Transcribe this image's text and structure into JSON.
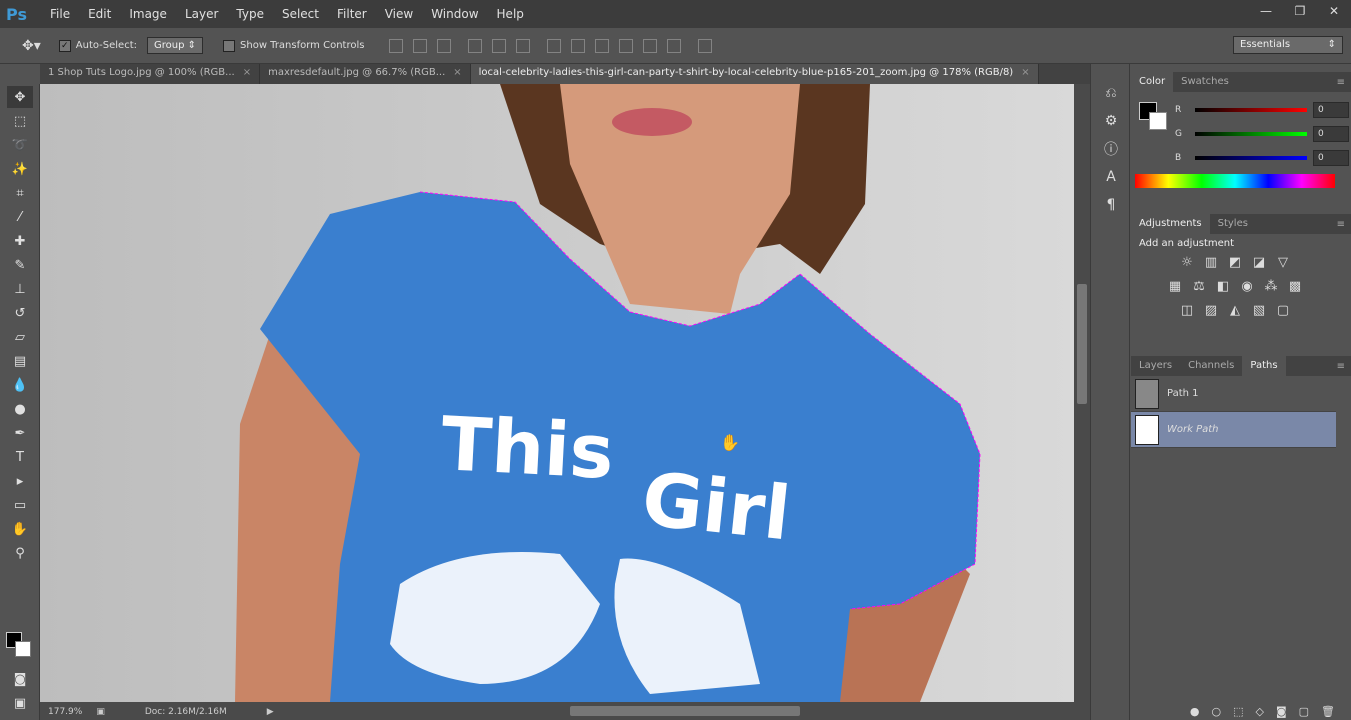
{
  "app": {
    "logo": "Ps"
  },
  "menu": [
    "File",
    "Edit",
    "Image",
    "Layer",
    "Type",
    "Select",
    "Filter",
    "View",
    "Window",
    "Help"
  ],
  "window_controls": {
    "minimize": "—",
    "restore": "❐",
    "close": "✕"
  },
  "options": {
    "autoselect_label": "Auto-Select:",
    "autoselect_value": "Group",
    "transform_label": "Show Transform Controls",
    "workspace": "Essentials"
  },
  "tabs": [
    {
      "label": "1 Shop Tuts Logo.jpg @ 100% (RGB..."
    },
    {
      "label": "maxresdefault.jpg @ 66.7% (RGB..."
    },
    {
      "label": "local-celebrity-ladies-this-girl-can-party-t-shirt-by-local-celebrity-blue-p165-201_zoom.jpg @ 178% (RGB/8)"
    }
  ],
  "tab_close": "×",
  "canvas": {
    "shirt_text_1": "This",
    "shirt_text_2": "Girl"
  },
  "status": {
    "zoom": "177.9%",
    "doc": "Doc: 2.16M/2.16M"
  },
  "color_panel": {
    "tab1": "Color",
    "tab2": "Swatches",
    "r_label": "R",
    "g_label": "G",
    "b_label": "B",
    "r": "0",
    "g": "0",
    "b": "0"
  },
  "adjustments_panel": {
    "tab1": "Adjustments",
    "tab2": "Styles",
    "title": "Add an adjustment"
  },
  "layers_panel": {
    "tab1": "Layers",
    "tab2": "Channels",
    "tab3": "Paths"
  },
  "paths": [
    {
      "name": "Path 1"
    },
    {
      "name": "Work Path"
    }
  ],
  "colors": {
    "selection_row": "#7a88a8",
    "accent": "#3f9ad6",
    "shirt": "#3a7fcf"
  }
}
